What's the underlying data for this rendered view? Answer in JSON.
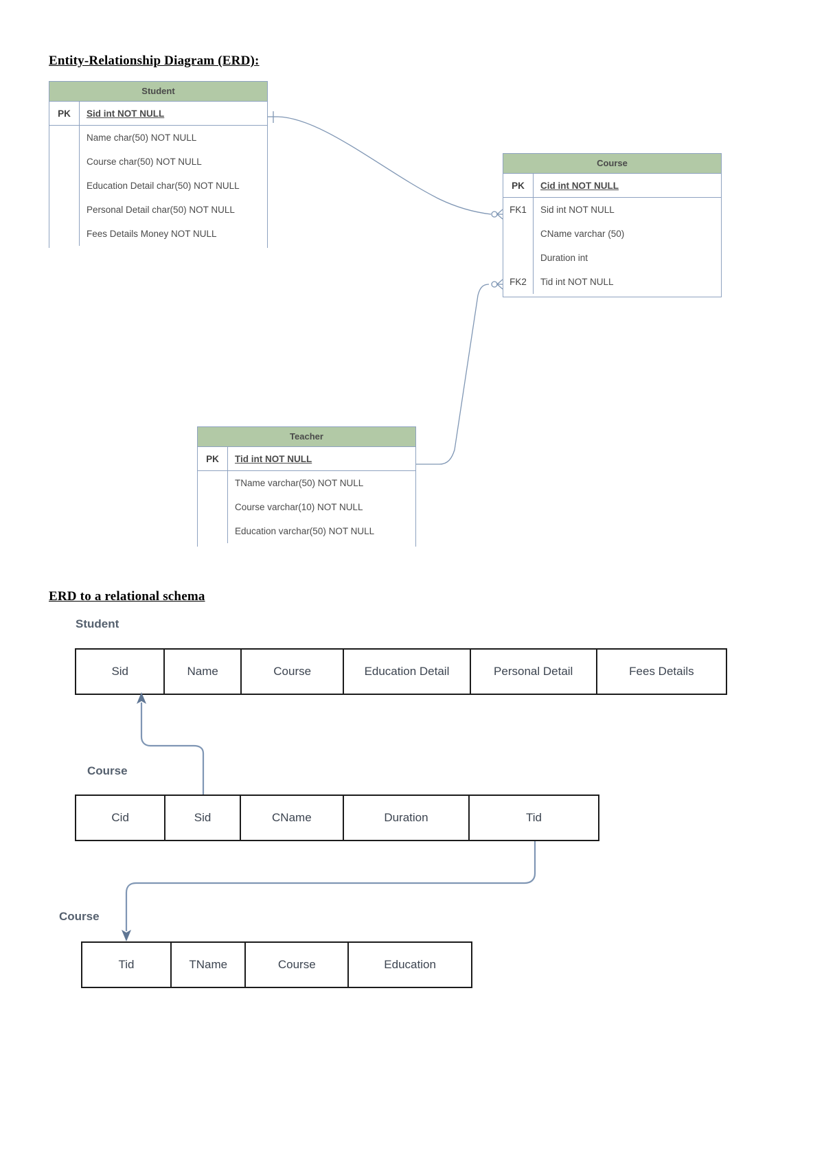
{
  "headings": {
    "erd": "Entity-Relationship Diagram (ERD):",
    "schema": "ERD to a relational schema"
  },
  "colors": {
    "entity_header_fill": "#b2c9a6",
    "entity_border": "#8ea2c0",
    "connector": "#7f96b4",
    "relation_border": "#1b1b1b",
    "relation_text": "#3c4450",
    "relation_label": "#55606e"
  },
  "erd": {
    "entities": [
      {
        "name": "Student",
        "rows": [
          {
            "key": "PK",
            "attribute": "Sid int NOT NULL",
            "is_key": true
          },
          {
            "key": "",
            "attribute": "Name char(50) NOT NULL",
            "is_key": false
          },
          {
            "key": "",
            "attribute": "Course char(50) NOT NULL",
            "is_key": false
          },
          {
            "key": "",
            "attribute": "Education Detail char(50) NOT NULL",
            "is_key": false
          },
          {
            "key": "",
            "attribute": "Personal Detail  char(50) NOT NULL",
            "is_key": false
          },
          {
            "key": "",
            "attribute": "Fees Details Money NOT NULL",
            "is_key": false
          }
        ]
      },
      {
        "name": "Course",
        "rows": [
          {
            "key": "PK",
            "attribute": "Cid int NOT NULL",
            "is_key": true
          },
          {
            "key": "FK1",
            "attribute": "Sid int NOT NULL",
            "is_key": false
          },
          {
            "key": "",
            "attribute": "CName varchar (50)",
            "is_key": false
          },
          {
            "key": "",
            "attribute": "Duration  int",
            "is_key": false
          },
          {
            "key": "FK2",
            "attribute": "Tid  int NOT NULL",
            "is_key": false
          }
        ]
      },
      {
        "name": "Teacher",
        "rows": [
          {
            "key": "PK",
            "attribute": "Tid  int NOT NULL",
            "is_key": true
          },
          {
            "key": "",
            "attribute": "TName varchar(50) NOT NULL",
            "is_key": false
          },
          {
            "key": "",
            "attribute": "Course varchar(10)  NOT NULL",
            "is_key": false
          },
          {
            "key": "",
            "attribute": "Education varchar(50) NOT NULL",
            "is_key": false
          }
        ]
      }
    ],
    "relationships": [
      {
        "from": "Student.Sid",
        "to": "Course.Sid",
        "notation": "one-to-many-crowsfoot"
      },
      {
        "from": "Teacher.Tid",
        "to": "Course.Tid",
        "notation": "one-to-many-crowsfoot"
      }
    ]
  },
  "schema": {
    "relations": [
      {
        "label": "Student",
        "columns": [
          "Sid",
          "Name",
          "Course",
          "Education Detail",
          "Personal Detail",
          "Fees Details"
        ]
      },
      {
        "label": "Course",
        "columns": [
          "Cid",
          "Sid",
          "CName",
          "Duration",
          "Tid"
        ]
      },
      {
        "label": "Course",
        "columns": [
          "Tid",
          "TName",
          "Course",
          "Education"
        ]
      }
    ],
    "foreign_keys": [
      {
        "from": "Course.Sid",
        "to": "Student.Sid"
      },
      {
        "from": "Course.Tid",
        "to": "Course.Tid"
      }
    ]
  }
}
